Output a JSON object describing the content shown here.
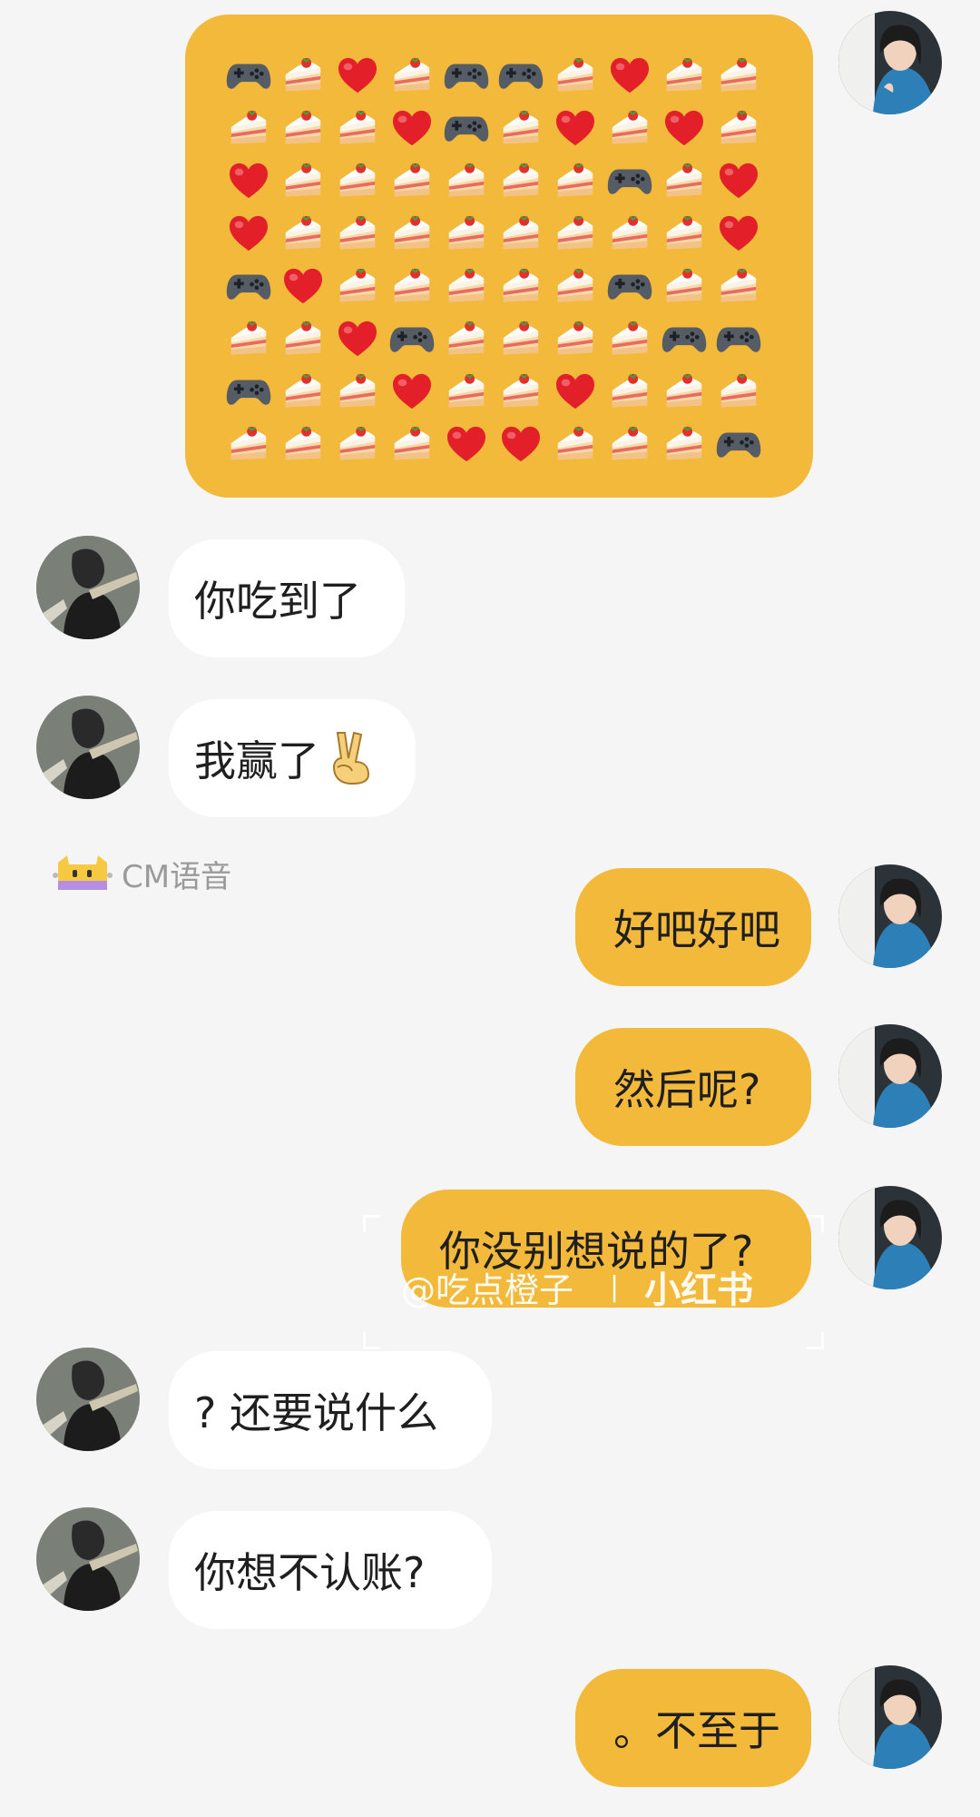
{
  "emoji_grid": [
    [
      "gamepad",
      "cake",
      "heart",
      "cake",
      "gamepad",
      "gamepad",
      "cake",
      "heart",
      "cake",
      "cake"
    ],
    [
      "cake",
      "cake",
      "cake",
      "heart",
      "gamepad",
      "cake",
      "heart",
      "cake",
      "heart",
      "cake"
    ],
    [
      "heart",
      "cake",
      "cake",
      "cake",
      "cake",
      "cake",
      "cake",
      "gamepad",
      "cake",
      "heart"
    ],
    [
      "heart",
      "cake",
      "cake",
      "cake",
      "cake",
      "cake",
      "cake",
      "cake",
      "cake",
      "heart"
    ],
    [
      "gamepad",
      "heart",
      "cake",
      "cake",
      "cake",
      "cake",
      "cake",
      "gamepad",
      "cake",
      "cake"
    ],
    [
      "cake",
      "cake",
      "heart",
      "gamepad",
      "cake",
      "cake",
      "cake",
      "cake",
      "gamepad",
      "gamepad"
    ],
    [
      "gamepad",
      "cake",
      "cake",
      "heart",
      "cake",
      "cake",
      "heart",
      "cake",
      "cake",
      "cake"
    ],
    [
      "cake",
      "cake",
      "cake",
      "cake",
      "heart",
      "heart",
      "cake",
      "cake",
      "cake",
      "gamepad"
    ]
  ],
  "messages": [
    {
      "side": "other",
      "text": "你吃到了"
    },
    {
      "side": "other",
      "text": "我赢了",
      "emoji": "victory-hand-icon"
    },
    {
      "side": "me",
      "text": "好吧好吧"
    },
    {
      "side": "me",
      "text": "然后呢?"
    },
    {
      "side": "me",
      "text": "你没别想说的了?"
    },
    {
      "side": "other",
      "text": "? 还要说什么"
    },
    {
      "side": "other",
      "text": "你想不认账?"
    },
    {
      "side": "me",
      "text": "。不至于"
    }
  ],
  "cm_logo": {
    "text": "CM语音"
  },
  "watermark": {
    "user": "@吃点橙子",
    "separator": "|",
    "brand": "小红书"
  },
  "colors": {
    "background": "#f5f5f5",
    "my_bubble": "#f2b93b",
    "other_bubble": "#ffffff",
    "text": "#1f1f1f"
  }
}
